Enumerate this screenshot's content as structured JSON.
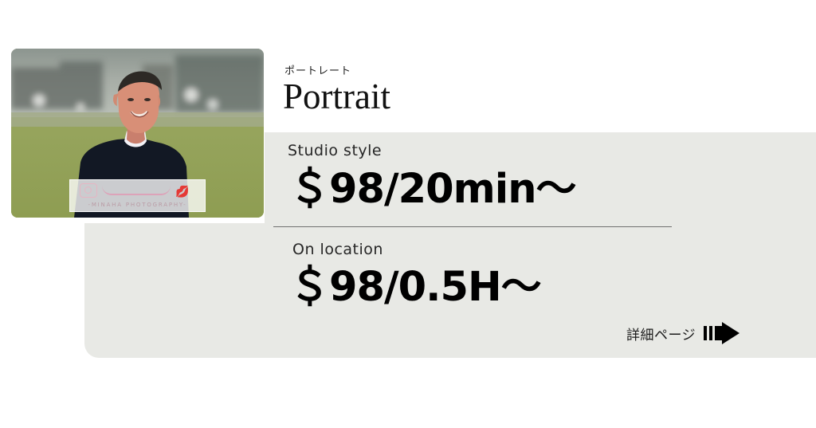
{
  "header": {
    "subtitle": "ポートレート",
    "title": "Portrait"
  },
  "photo": {
    "watermark_text": "-MINAHA PHOTOGRAPHY-"
  },
  "pricing": {
    "studio": {
      "label": "Studio style",
      "price": "＄98/20min〜"
    },
    "location": {
      "label": "On location",
      "price": "＄98/0.5H〜"
    }
  },
  "link": {
    "label": "詳細ページ",
    "icon": "arrow-right-icon"
  },
  "colors": {
    "panel": "#e8e9e5",
    "text": "#000000",
    "watermark_lips": "#d9251c"
  }
}
